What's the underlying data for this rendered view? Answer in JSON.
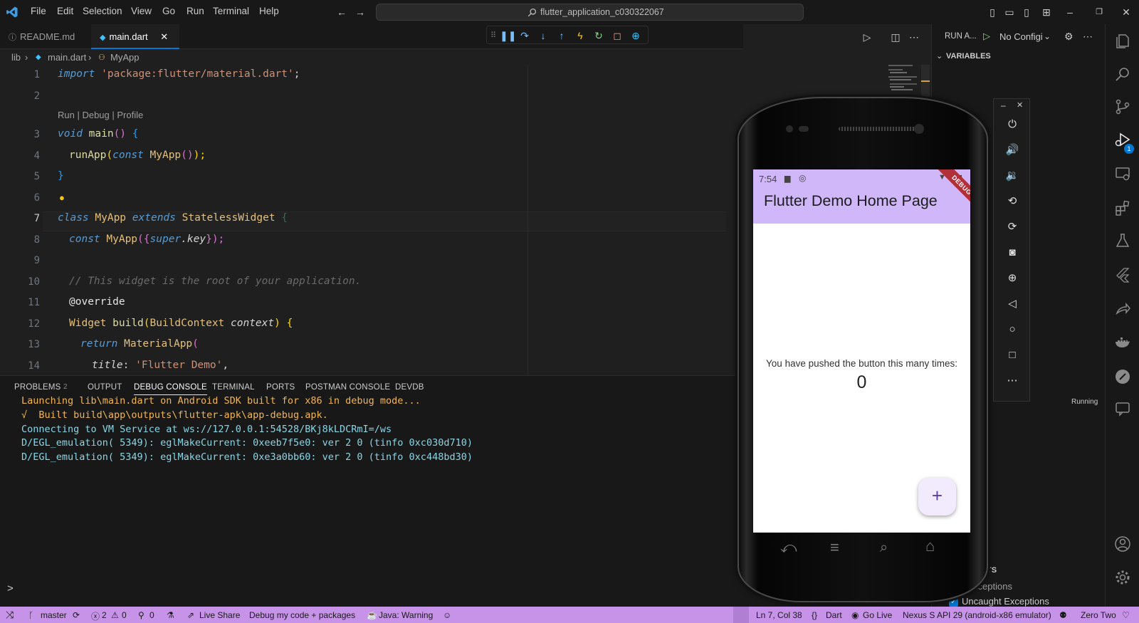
{
  "menu": [
    "File",
    "Edit",
    "Selection",
    "View",
    "Go",
    "Run",
    "Terminal",
    "Help"
  ],
  "search": {
    "text": "flutter_application_c030322067"
  },
  "tabs": [
    {
      "label": "README.md",
      "icon": "info-icon"
    },
    {
      "label": "main.dart",
      "icon": "dart-icon",
      "close": "✕"
    }
  ],
  "breadcrumb": [
    "lib",
    "main.dart",
    "MyApp"
  ],
  "editor": {
    "line_numbers": [
      "1",
      "2",
      "3",
      "4",
      "5",
      "6",
      "7",
      "8",
      "9",
      "10",
      "11",
      "12",
      "13",
      "14"
    ],
    "code_lens": "Run | Debug | Profile",
    "lines": {
      "l1a": "import",
      "l1b": "'package:flutter/material.dart'",
      "l1c": ";",
      "l3a": "void",
      "l3b": "main",
      "l3c": "()",
      "l3d": " {",
      "l4a": "runApp",
      "l4b": "(",
      "l4c": "const",
      "l4d": "MyApp",
      "l4e": "()",
      "l4f": ");",
      "l5": "}",
      "l7a": "class",
      "l7b": "MyApp",
      "l7c": "extends",
      "l7d": "StatelessWidget",
      "l7e": " {",
      "l8a": "const",
      "l8b": "MyApp",
      "l8c": "({",
      "l8d": "super",
      "l8e": ".key",
      "l8f": "});",
      "l10": "// This widget is the root of your application.",
      "l11": "@override",
      "l12a": "Widget",
      "l12b": "build",
      "l12c": "(",
      "l12d": "BuildContext",
      "l12e": "context",
      "l12f": ") {",
      "l13a": "return",
      "l13b": "MaterialApp",
      "l13c": "(",
      "l14a": "title",
      "l14b": ": ",
      "l14c": "'Flutter Demo'",
      "l14d": ","
    }
  },
  "panel": {
    "tabs": [
      "PROBLEMS",
      "OUTPUT",
      "DEBUG CONSOLE",
      "TERMINAL",
      "PORTS",
      "POSTMAN CONSOLE",
      "DEVDB"
    ],
    "problems_count": "2",
    "console": [
      "Launching lib\\main.dart on Android SDK built for x86 in debug mode...",
      "√  Built build\\app\\outputs\\flutter-apk\\app-debug.apk.",
      "Connecting to VM Service at ws://127.0.0.1:54528/BKj8kLDCRmI=/ws",
      "D/EGL_emulation( 5349): eglMakeCurrent: 0xeeb7f5e0: ver 2 0 (tinfo 0xc030d710)",
      "D/EGL_emulation( 5349): eglMakeCurrent: 0xe3a0bb60: ver 2 0 (tinfo 0xc448bd30)"
    ],
    "prompt": ">"
  },
  "run_sidebar": {
    "title": "RUN A...",
    "config": "No Configi",
    "variables": "VARIABLES",
    "running": "Running",
    "breakpoints": "INTS",
    "bp_all": "ll Exceptions",
    "bp_uncaught": "Uncaught Exceptions"
  },
  "phone": {
    "time": "7:54",
    "debug_banner": "DEBUG",
    "title": "Flutter Demo Home Page",
    "message": "You have pushed the button this many times:",
    "counter": "0",
    "fab": "+"
  },
  "statusbar": {
    "branch": "master",
    "errors": "2",
    "warnings": "0",
    "ports": "0",
    "live_share": "Live Share",
    "debug_mode": "Debug my code + packages",
    "java": "Java: Warning",
    "position": "Ln 7, Col 38",
    "language": "Dart",
    "go_live": "Go Live",
    "device": "Nexus S API 29 (android-x86 emulator)",
    "zero_two": "Zero Two"
  },
  "colors": {
    "status_bar": "#c793e8",
    "app_bar": "#d0b7fa",
    "accent": "#0078d4",
    "console_orange": "#f0b654",
    "console_cyan": "#8ad6e5"
  }
}
